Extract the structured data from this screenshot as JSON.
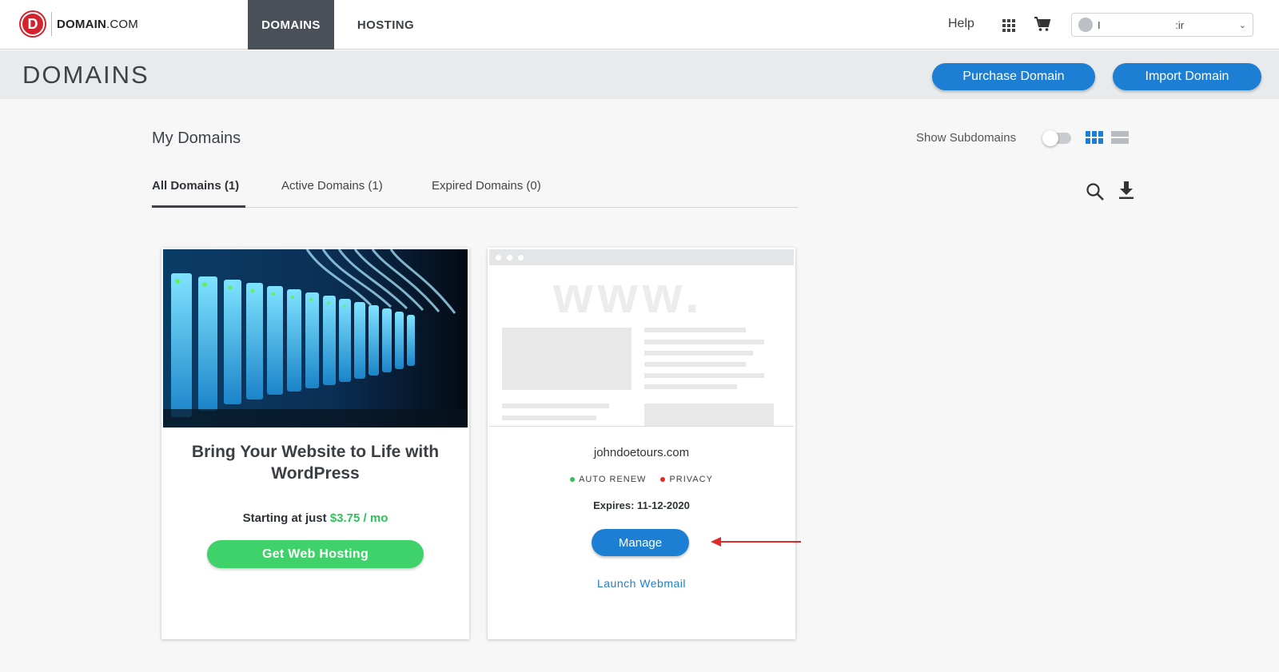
{
  "brand": {
    "logo_letter": "D",
    "logo_text_bold": "DOMAIN",
    "logo_text_rest": ".COM"
  },
  "nav": {
    "domains": "DOMAINS",
    "hosting": "HOSTING",
    "help": "Help",
    "account_name": "I                                    :ir",
    "account_chevron": "⌄"
  },
  "header": {
    "title": "DOMAINS",
    "purchase_label": "Purchase Domain",
    "import_label": "Import Domain"
  },
  "section": {
    "title": "My Domains",
    "show_subdomains": "Show Subdomains"
  },
  "tabs": [
    {
      "label": "All Domains (1)"
    },
    {
      "label": "Active Domains (1)"
    },
    {
      "label": "Expired Domains (0)"
    }
  ],
  "promo": {
    "title": "Bring Your Website to Life with WordPress",
    "price_prefix": "Starting at just ",
    "price": "$3.75 / mo",
    "button": "Get Web Hosting"
  },
  "domain_card": {
    "preview_text": "www.",
    "domain": "johndoetours.com",
    "auto_renew": "AUTO RENEW",
    "privacy": "PRIVACY",
    "expires": "Expires: 11-12-2020",
    "manage": "Manage",
    "webmail": "Launch Webmail"
  },
  "colors": {
    "accent": "#1d7fd4",
    "green": "#3fd16a",
    "brand_red": "#d3232f",
    "annotation_arrow": "#e02a2a"
  }
}
